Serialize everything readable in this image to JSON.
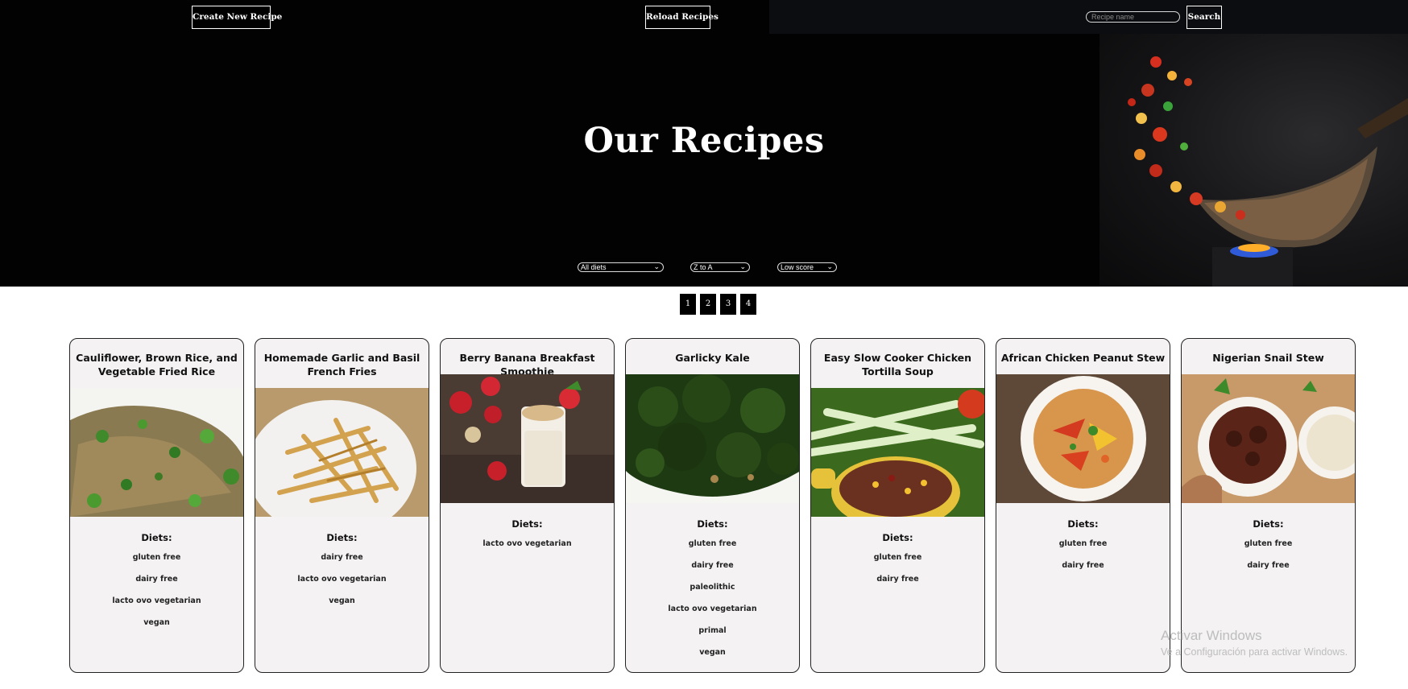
{
  "header": {
    "create_label": "Create New Recipe",
    "reload_label": "Reload Recipes",
    "search_placeholder": "Recipe name",
    "search_label": "Search"
  },
  "hero": {
    "title": "Our Recipes"
  },
  "filters": {
    "diet": "All diets",
    "order": "Z to A",
    "score": "Low score"
  },
  "pagination": [
    "1",
    "2",
    "3",
    "4"
  ],
  "diets_heading": "Diets:",
  "cards": [
    {
      "title": "Cauliflower, Brown Rice, and Vegetable Fried Rice",
      "diets": [
        "gluten free",
        "dairy free",
        "lacto ovo vegetarian",
        "vegan"
      ]
    },
    {
      "title": "Homemade Garlic and Basil French Fries",
      "diets": [
        "dairy free",
        "lacto ovo vegetarian",
        "vegan"
      ]
    },
    {
      "title": "Berry Banana Breakfast Smoothie",
      "diets": [
        "lacto ovo vegetarian"
      ]
    },
    {
      "title": "Garlicky Kale",
      "diets": [
        "gluten free",
        "dairy free",
        "paleolithic",
        "lacto ovo vegetarian",
        "primal",
        "vegan"
      ]
    },
    {
      "title": "Easy Slow Cooker Chicken Tortilla Soup",
      "diets": [
        "gluten free",
        "dairy free"
      ]
    },
    {
      "title": "African Chicken Peanut Stew",
      "diets": [
        "gluten free",
        "dairy free"
      ]
    },
    {
      "title": "Nigerian Snail Stew",
      "diets": [
        "gluten free",
        "dairy free"
      ]
    }
  ],
  "watermark": {
    "line1": "Activar Windows",
    "line2": "Ve a Configuración para activar Windows."
  }
}
